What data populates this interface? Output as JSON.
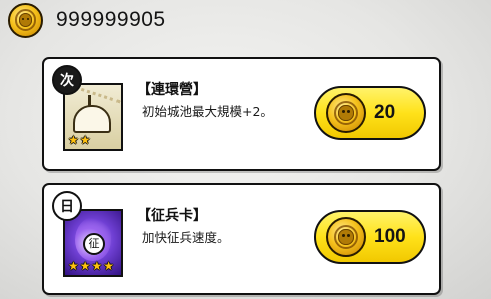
{
  "currency": {
    "amount": "999999905",
    "icon": "gold-coin-icon"
  },
  "items": [
    {
      "badge": "次",
      "title": "【連環營】",
      "description": "初始城池最大規模+2。",
      "stars": 2,
      "price": "20",
      "thumb": "camp-tent-icon"
    },
    {
      "badge": "日",
      "title": "【征兵卡】",
      "description": "加快征兵速度。",
      "stars": 4,
      "price": "100",
      "thumb": "conscription-seal-icon",
      "seal_char": "征"
    }
  ],
  "colors": {
    "button_yellow": "#ffe21a",
    "coin_gold": "#f6c21d",
    "star_gold": "#ffc10f",
    "card_border": "#111111"
  }
}
